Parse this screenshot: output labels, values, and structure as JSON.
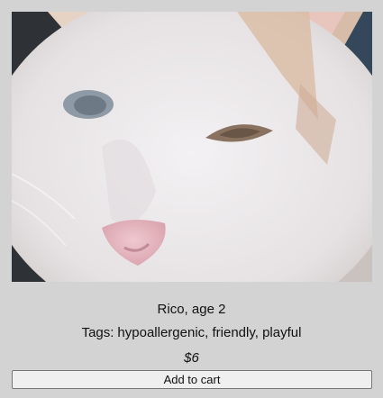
{
  "listing": {
    "photo_alt": "white cat photo",
    "name_age": "Rico, age 2",
    "tags_label": "Tags:",
    "tags": "hypoallergenic, friendly, playful",
    "price": "$6",
    "add_button_label": "Add to cart"
  }
}
